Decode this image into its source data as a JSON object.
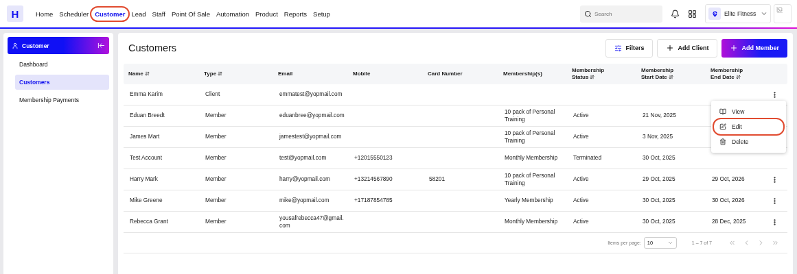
{
  "logo": {
    "letter": "H"
  },
  "nav": [
    {
      "label": "Home",
      "selected": false,
      "annotated": false
    },
    {
      "label": "Scheduler",
      "selected": false,
      "annotated": false
    },
    {
      "label": "Customer",
      "selected": true,
      "annotated": true
    },
    {
      "label": "Lead",
      "selected": false,
      "annotated": false
    },
    {
      "label": "Staff",
      "selected": false,
      "annotated": false
    },
    {
      "label": "Point Of Sale",
      "selected": false,
      "annotated": false
    },
    {
      "label": "Automation",
      "selected": false,
      "annotated": false
    },
    {
      "label": "Product",
      "selected": false,
      "annotated": false
    },
    {
      "label": "Reports",
      "selected": false,
      "annotated": false
    },
    {
      "label": "Setup",
      "selected": false,
      "annotated": false
    }
  ],
  "search": {
    "placeholder": "Search"
  },
  "location": {
    "name": "Elite Fitness"
  },
  "sidebar": {
    "title": "Customer",
    "items": [
      {
        "label": "Dashboard",
        "selected": false
      },
      {
        "label": "Customers",
        "selected": true
      },
      {
        "label": "Membership Payments",
        "selected": false
      }
    ]
  },
  "page": {
    "title": "Customers",
    "buttons": [
      {
        "label": "Filters",
        "kind": "filter"
      },
      {
        "label": "Add Client",
        "kind": "add"
      },
      {
        "label": "Add Member",
        "kind": "primary"
      }
    ]
  },
  "table": {
    "columns": [
      {
        "label": "Name",
        "sortable": true
      },
      {
        "label": "Type",
        "sortable": true
      },
      {
        "label": "Email",
        "sortable": false
      },
      {
        "label": "Mobile",
        "sortable": false
      },
      {
        "label": "Card Number",
        "sortable": false
      },
      {
        "label": "Membership(s)",
        "sortable": false
      },
      {
        "label": "Membership Status",
        "sortable": true
      },
      {
        "label": "Membership Start Date",
        "sortable": true
      },
      {
        "label": "Membership End Date",
        "sortable": true
      }
    ],
    "rows": [
      {
        "cells": [
          "Emma Karim",
          "Client",
          "emmatest@yopmail.com",
          "",
          "",
          "",
          "",
          "",
          ""
        ],
        "actions": true
      },
      {
        "cells": [
          "Eduan Breedt",
          "Member",
          "eduanbree@yopmail.com",
          "",
          "",
          "10 pack of Personal Training",
          "Active",
          "21 Nov, 2025",
          ""
        ],
        "actions": false
      },
      {
        "cells": [
          "James Mart",
          "Member",
          "jamestest@yopmail.com",
          "",
          "",
          "10 pack of Personal Training",
          "Active",
          "3 Nov, 2025",
          ""
        ],
        "actions": false
      },
      {
        "cells": [
          "Test Account",
          "Member",
          "test@yopmail.com",
          "+12015550123",
          "",
          "Monthly Membership",
          "Terminated",
          "30 Oct, 2025",
          ""
        ],
        "actions": false
      },
      {
        "cells": [
          "Harry Mark",
          "Member",
          "harry@yopmail.com",
          "+13214567890",
          "58201",
          "10 pack of Personal Training",
          "Active",
          "29 Oct, 2025",
          "29 Oct, 2026"
        ],
        "actions": true
      },
      {
        "cells": [
          "Mike Greene",
          "Member",
          "mike@yopmail.com",
          "+17187854785",
          "",
          "Yearly Membership",
          "Active",
          "30 Oct, 2025",
          "30 Oct, 2026"
        ],
        "actions": true
      },
      {
        "cells": [
          "Rebecca Grant",
          "Member",
          "yousafrebecca47@gmail.com",
          "",
          "",
          "Monthly Membership",
          "Active",
          "30 Oct, 2025",
          "28 Dec, 2025"
        ],
        "actions": true
      }
    ]
  },
  "row_menu": {
    "items": [
      {
        "label": "View",
        "kind": "view",
        "annotated": false
      },
      {
        "label": "Edit",
        "kind": "edit",
        "annotated": true
      },
      {
        "label": "Delete",
        "kind": "delete",
        "annotated": false
      }
    ]
  },
  "pagination": {
    "items_per_page_label": "Items per page:",
    "page_size": "10",
    "range": "1 – 7 of 7"
  }
}
